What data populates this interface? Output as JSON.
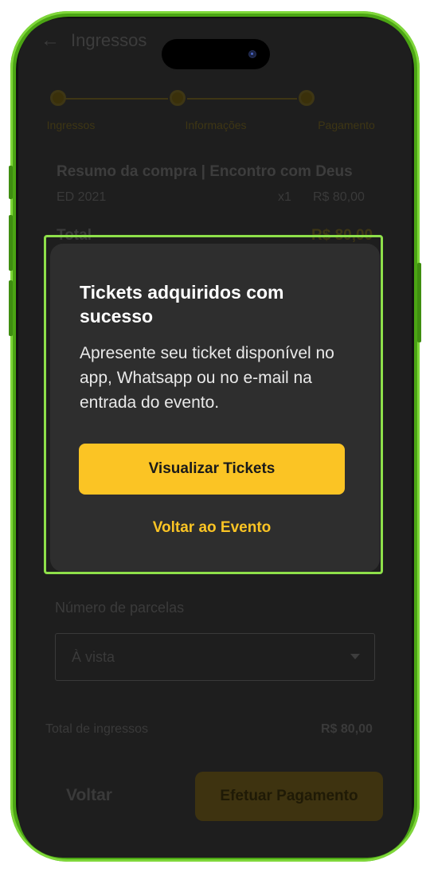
{
  "header": {
    "title": "Ingressos"
  },
  "steps": [
    {
      "label": "Ingressos"
    },
    {
      "label": "Informações"
    },
    {
      "label": "Pagamento"
    }
  ],
  "summary": {
    "title": "Resumo da compra | Encontro com Deus",
    "item_name": "ED 2021",
    "item_qty": "x1",
    "item_price": "R$ 80,00",
    "total_label": "Total",
    "total_value": "R$ 80,00"
  },
  "installments": {
    "label": "Número de parcelas",
    "selected": "À vista"
  },
  "tickets_total": {
    "label": "Total de ingressos",
    "value": "R$ 80,00"
  },
  "footer": {
    "back_label": "Voltar",
    "pay_label": "Efetuar Pagamento"
  },
  "modal": {
    "title": "Tickets adquiridos com sucesso",
    "body": "Apresente seu ticket disponível no app, Whatsapp ou no e-mail na entrada do evento.",
    "primary_label": "Visualizar Tickets",
    "secondary_label": "Voltar ao Evento"
  },
  "colors": {
    "accent": "#fbc424",
    "modal_bg": "#2e2e2e",
    "frame_green": "#4ba514",
    "highlight": "#8ee04a"
  }
}
